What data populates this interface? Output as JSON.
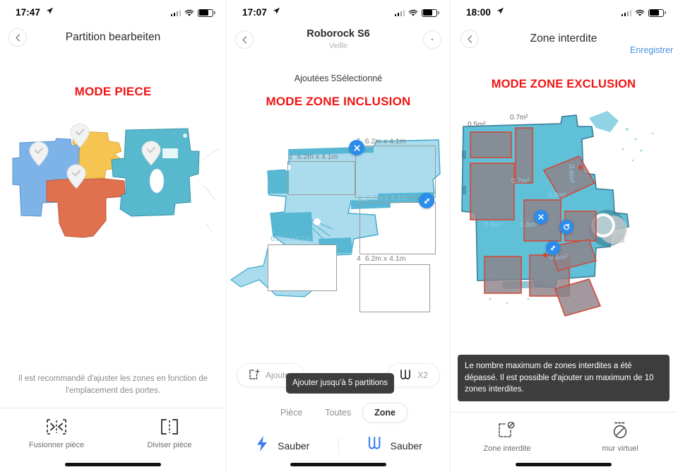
{
  "panels": [
    {
      "id": "partition-edit",
      "status": {
        "time": "17:47",
        "location_icon": "location-arrow-icon",
        "signal_icon": "cellular-bars-icon",
        "wifi_icon": "wifi-icon",
        "battery_icon": "battery-icon"
      },
      "nav": {
        "back_icon": "chevron-left-icon",
        "title": "Partition bearbeiten"
      },
      "mode_label": "MODE PIECE",
      "map": {
        "type": "room-partition-map",
        "rooms": [
          {
            "name": "room-blue",
            "color": "#7eb3e8"
          },
          {
            "name": "room-yellow",
            "color": "#f5c451"
          },
          {
            "name": "room-orange",
            "color": "#e0714f"
          },
          {
            "name": "room-teal",
            "color": "#58b8cd"
          }
        ],
        "pins": 4,
        "pin_icon": "room-pin-icon"
      },
      "hint": "Il est recommandé d'ajuster les zones en fonction de l'emplacement des portes.",
      "tabs": [
        {
          "icon": "merge-room-icon",
          "label": "Fusionner pièce"
        },
        {
          "icon": "split-room-icon",
          "label": "Diviser pièce"
        }
      ]
    },
    {
      "id": "zone-inclusion",
      "status": {
        "time": "17:07",
        "location_icon": "location-arrow-icon",
        "signal_icon": "cellular-bars-icon",
        "wifi_icon": "wifi-icon",
        "battery_icon": "battery-icon"
      },
      "nav": {
        "back_icon": "chevron-left-icon",
        "title": "Roborock S6",
        "subtitle": "Veille",
        "more_icon": "ellipsis-icon"
      },
      "count_line": "Ajoutées 5Sélectionné",
      "mode_label": "MODE ZONE INCLUSION",
      "map": {
        "type": "zone-inclusion-map",
        "zones": [
          {
            "number": "1",
            "size": "6.2m x 4.1m",
            "faded": false
          },
          {
            "number": "5",
            "size": "6.2m x 4.1m",
            "faded": false
          },
          {
            "number": "2",
            "size": "6.2m x 4.1m",
            "faded": true
          },
          {
            "number": "3",
            "size": "6.2m x 4.1m",
            "faded": true
          },
          {
            "number": "4",
            "size": "6.2m x 4.1m",
            "faded": false
          }
        ],
        "handles": [
          {
            "name": "close-zone-handle",
            "icon": "x-icon"
          },
          {
            "name": "resize-zone-handle",
            "icon": "resize-diagonal-icon"
          }
        ]
      },
      "add_button": {
        "icon": "add-square-icon",
        "label": "Ajouter"
      },
      "tooltip": "Ajouter jusqu'à 5 partitions",
      "repeat_button": {
        "icon": "zigzag-icon",
        "label": "X2"
      },
      "segments": [
        {
          "label": "Pièce",
          "active": false
        },
        {
          "label": "Toutes",
          "active": false
        },
        {
          "label": "Zone",
          "active": true
        }
      ],
      "clean_actions": [
        {
          "icon": "bolt-icon",
          "label": "Sauber",
          "color": "#3b7ff0"
        },
        {
          "icon": "zigzag-icon",
          "label": "Sauber",
          "color": "#3b7ff0"
        }
      ]
    },
    {
      "id": "zone-interdite",
      "status": {
        "time": "18:00",
        "location_icon": "location-arrow-icon",
        "signal_icon": "cellular-bars-icon",
        "wifi_icon": "wifi-icon",
        "battery_icon": "battery-icon"
      },
      "nav": {
        "back_icon": "chevron-left-icon",
        "title": "Zone interdite",
        "save_label": "Enregistrer"
      },
      "mode_label": "MODE ZONE EXCLUSION",
      "map": {
        "type": "forbidden-zone-map",
        "floor_color": "#5fc0d8",
        "zone_fill": "#8d8189",
        "zone_stroke": "#d04a3a",
        "area_labels": [
          {
            "text": "0.5m²",
            "dim": false
          },
          {
            "text": "0.7m²",
            "dim": false
          },
          {
            "text": "0.7m²",
            "dim": true
          },
          {
            "text": "0.8m²",
            "dim": true
          },
          {
            "text": "0.8m²",
            "dim": true
          },
          {
            "text": "0.6m²",
            "dim": true
          },
          {
            "text": "0.5m²",
            "dim": true
          },
          {
            "text": "0.6m²",
            "dim": true
          }
        ],
        "handles": [
          {
            "name": "close-zone-handle",
            "icon": "x-icon"
          },
          {
            "name": "rotate-zone-handle",
            "icon": "rotate-icon"
          },
          {
            "name": "resize-zone-handle",
            "icon": "resize-diagonal-icon"
          }
        ]
      },
      "toast": "Le nombre maximum de zones interdites a été dépassé. Il est possible d'ajouter un maximum de 10 zones interdites.",
      "tabs": [
        {
          "icon": "forbidden-zone-icon",
          "label": "Zone interdite"
        },
        {
          "icon": "virtual-wall-icon",
          "label": "mur virtuel"
        }
      ]
    }
  ],
  "colors": {
    "mode_red": "#f01414",
    "accent_blue": "#2b8ceb",
    "link_blue": "#4a90e2",
    "toast_bg": "#3d3d3d"
  }
}
